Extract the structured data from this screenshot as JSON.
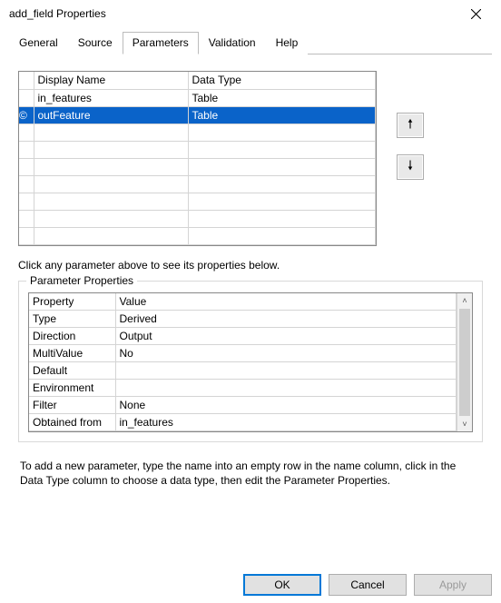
{
  "window": {
    "title": "add_field Properties"
  },
  "tabs": {
    "items": [
      "General",
      "Source",
      "Parameters",
      "Validation",
      "Help"
    ],
    "active": 2
  },
  "paramGrid": {
    "headers": {
      "display": "Display Name",
      "dataType": "Data Type"
    },
    "rows": [
      {
        "display": "in_features",
        "dataType": "Table",
        "selected": false
      },
      {
        "display": "outFeature",
        "dataType": "Table",
        "selected": true,
        "marker": "©"
      }
    ],
    "emptyRows": 7
  },
  "hints": {
    "clickParam": "Click any parameter above to see its properties below.",
    "addParam": "To add a new parameter, type the name into an empty row in the name column, click in the Data Type column to choose a data type, then edit the Parameter Properties."
  },
  "propPanel": {
    "title": "Parameter Properties",
    "headers": {
      "prop": "Property",
      "val": "Value"
    },
    "rows": [
      {
        "prop": "Type",
        "val": "Derived"
      },
      {
        "prop": "Direction",
        "val": "Output"
      },
      {
        "prop": "MultiValue",
        "val": "No"
      },
      {
        "prop": "Default",
        "val": ""
      },
      {
        "prop": "Environment",
        "val": ""
      },
      {
        "prop": "Filter",
        "val": "None"
      },
      {
        "prop": "Obtained from",
        "val": "in_features"
      }
    ]
  },
  "buttons": {
    "ok": "OK",
    "cancel": "Cancel",
    "apply": "Apply"
  }
}
